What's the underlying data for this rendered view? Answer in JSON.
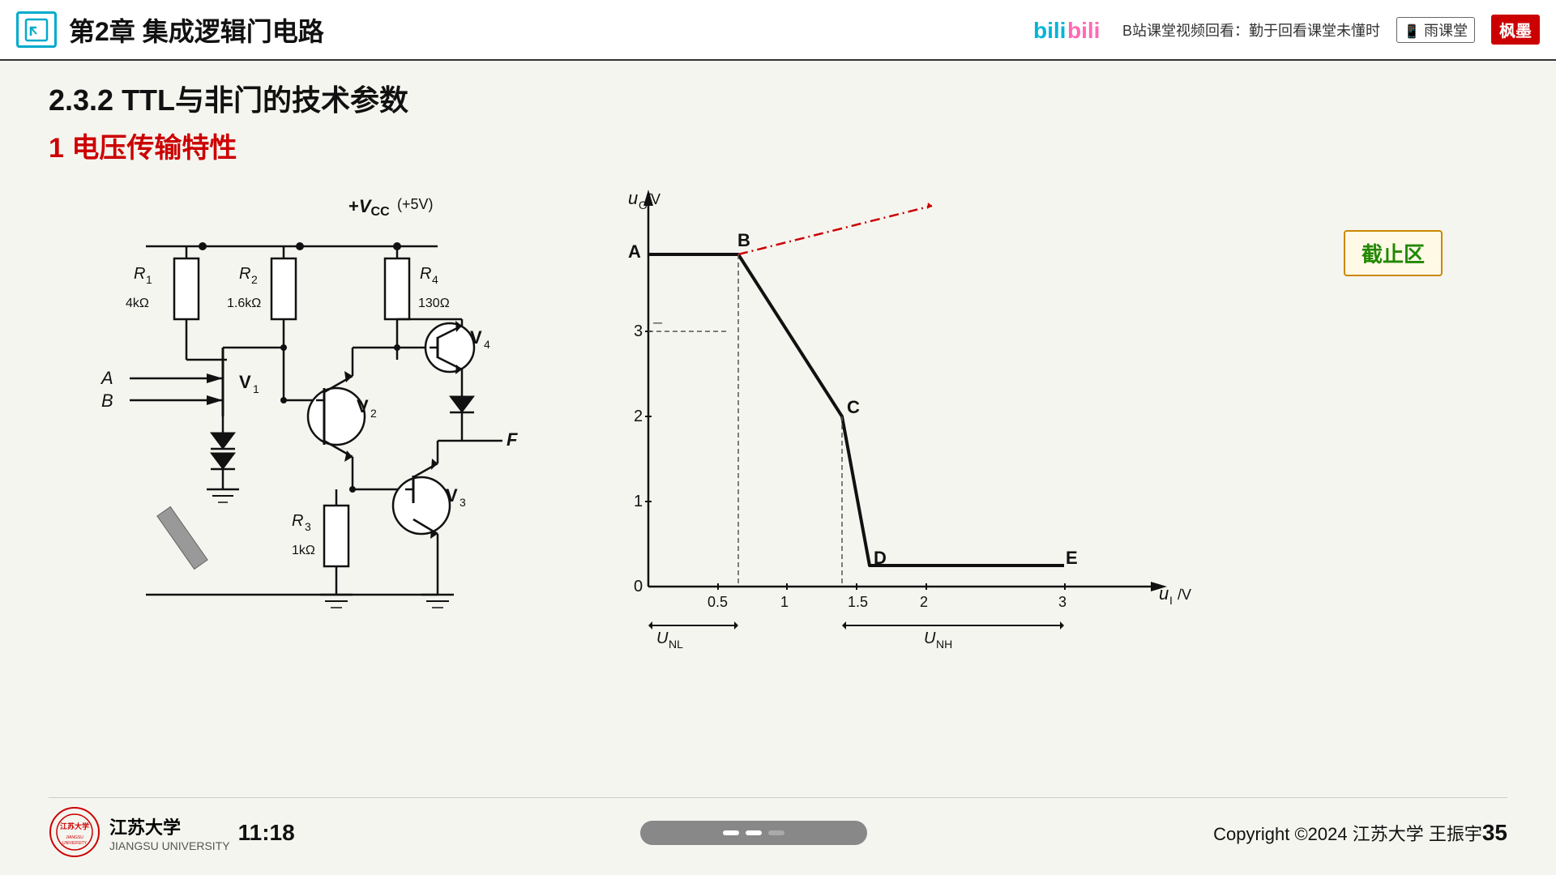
{
  "header": {
    "logo_alt": "course logo",
    "chapter_title": "第2章 集成逻辑门电路",
    "bilibili_text": "bilibili",
    "bilibili_subtext": "B站课堂视频回看：勤于回看课堂未懂时",
    "rain_class": "雨课堂",
    "brand": "枫墨"
  },
  "section": {
    "title": "2.3.2  TTL与非门的技术参数",
    "subtitle": "1 电压传输特性"
  },
  "circuit": {
    "vcc_label": "+V",
    "vcc_sub": "CC",
    "plus5v": "(+5V)",
    "r1_label": "R",
    "r1_sub": "1",
    "r1_val": "4kΩ",
    "r2_label": "R",
    "r2_sub": "2",
    "r2_val": "1.6kΩ",
    "r3_label": "R",
    "r3_sub": "3",
    "r4_label": "R",
    "r4_sub": "4",
    "r4_val": "130Ω",
    "r3_val": "1kΩ",
    "v1_label": "V",
    "v1_sub": "1",
    "v2_label": "V",
    "v2_sub": "2",
    "v3_label": "V",
    "v3_sub": "3",
    "v4_label": "V",
    "v4_sub": "4",
    "input_a": "A",
    "input_b": "B",
    "output_f": "F"
  },
  "graph": {
    "y_axis_label": "u",
    "y_axis_sub": "O",
    "y_axis_unit": "/V",
    "x_axis_label": "u",
    "x_axis_sub": "I",
    "x_axis_unit": "/V",
    "point_a": "A",
    "point_b": "B",
    "point_c": "C",
    "point_d": "D",
    "point_e": "E",
    "y_ticks": [
      "1",
      "2",
      "3"
    ],
    "x_ticks": [
      "0.5",
      "1",
      "1.5",
      "2",
      "3"
    ],
    "unl_label": "U",
    "unl_sub": "NL",
    "unh_label": "U",
    "unh_sub": "NH",
    "cutoff_label": "截止区",
    "dash_y": "–"
  },
  "footer": {
    "university": "江苏大学",
    "university_en": "JIANGSU UNIVERSITY",
    "time": "11:18",
    "copyright": "Copyright ©2024 江苏大学 王振宇",
    "page_num": "35"
  }
}
